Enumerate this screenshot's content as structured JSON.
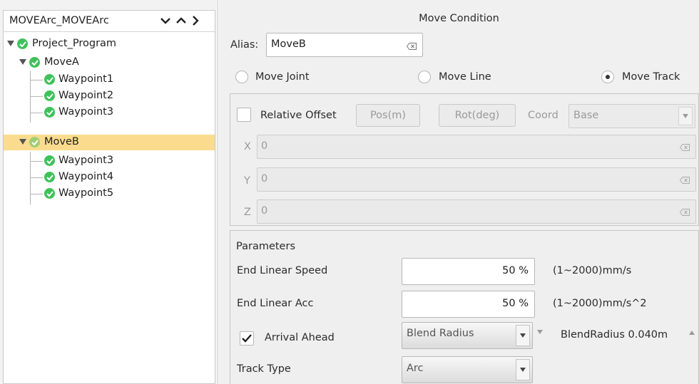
{
  "tree": {
    "title": "MOVEArc_MOVEArc",
    "nodes": [
      {
        "label": "Project_Program"
      },
      {
        "label": "MoveA"
      },
      {
        "label": "Waypoint1"
      },
      {
        "label": "Waypoint2"
      },
      {
        "label": "Waypoint3"
      },
      {
        "label": "MoveB"
      },
      {
        "label": "Waypoint3"
      },
      {
        "label": "Waypoint4"
      },
      {
        "label": "Waypoint5"
      }
    ],
    "selected": "MoveB"
  },
  "panel": {
    "title": "Move Condition",
    "alias_label": "Alias:",
    "alias_value": "MoveB",
    "move_types": [
      "Move Joint",
      "Move Line",
      "Move Track"
    ],
    "selected_move_type": "Move Track",
    "offset": {
      "relative_label": "Relative Offset",
      "pos_button": "Pos(m)",
      "rot_button": "Rot(deg)",
      "coord_label": "Coord",
      "coord_value": "Base",
      "x_label": "X",
      "x_value": "0",
      "y_label": "Y",
      "y_value": "0",
      "z_label": "Z",
      "z_value": "0"
    },
    "parameters": {
      "title": "Parameters",
      "speed_label": "End Linear Speed",
      "speed_value": "50 %",
      "speed_range": "(1~2000)mm/s",
      "acc_label": "End Linear Acc",
      "acc_value": "50 %",
      "acc_range": "(1~2000)mm/s^2",
      "arrival_label": "Arrival Ahead",
      "arrival_checked": true,
      "arrival_mode": "Blend Radius",
      "blend_label": "BlendRadius 0.040m",
      "track_type_label": "Track Type",
      "track_type_value": "Arc"
    }
  },
  "colors": {
    "selection": "#fbdc8e",
    "check_green": "#3ec25a",
    "panel_bg": "#f0f0f0"
  }
}
